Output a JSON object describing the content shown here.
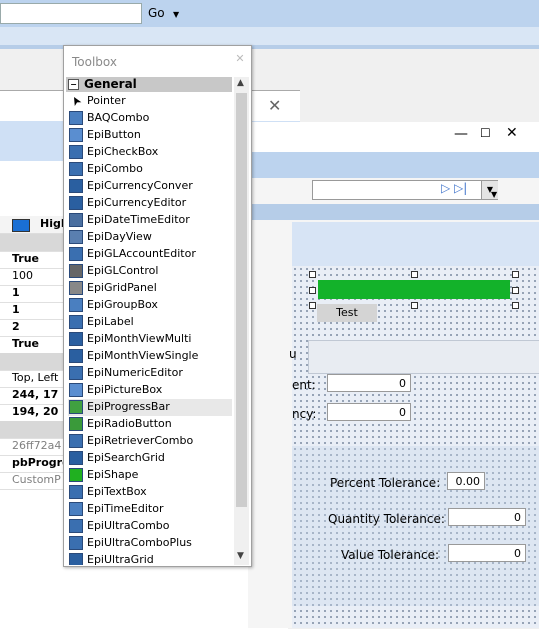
{
  "topbar": {
    "go_label": "Go",
    "go_dropdown": "▼"
  },
  "left_window": {
    "close_glyph": "✕",
    "header_text": "High",
    "rows": [
      {
        "text": "",
        "style": "h"
      },
      {
        "text": "True",
        "style": "b"
      },
      {
        "text": "100",
        "style": ""
      },
      {
        "text": "1",
        "style": "b"
      },
      {
        "text": "1",
        "style": "b"
      },
      {
        "text": "2",
        "style": "b"
      },
      {
        "text": "True",
        "style": "b"
      },
      {
        "text": "",
        "style": "h"
      },
      {
        "text": "Top, Left",
        "style": ""
      },
      {
        "text": "244, 17",
        "style": "b"
      },
      {
        "text": "194, 20",
        "style": "b"
      },
      {
        "text": "",
        "style": "h"
      },
      {
        "text": "26ff72a4",
        "style": "g"
      },
      {
        "text": "pbProgre",
        "style": "b"
      },
      {
        "text": "CustomP",
        "style": "g"
      }
    ]
  },
  "form_window": {
    "min_glyph": "—",
    "max_glyph": "☐",
    "close_glyph": "✕",
    "nav_glyphs": "▷ ▷|",
    "dropdown_glyph": "▼",
    "test_button": "Test",
    "field_labels": {
      "ent": "ent:",
      "ncy": "ncy:",
      "u": "u"
    },
    "ent_value": "0",
    "ncy_value": "0",
    "percent_label": "Percent Tolerance:",
    "percent_value": "0.00",
    "quantity_label": "Quantity Tolerance:",
    "quantity_value": "0",
    "value_label": "Value Tolerance:",
    "value_value": "0"
  },
  "toolbox": {
    "title": "Toolbox",
    "close_glyph": "✕",
    "group_label": "General",
    "group_toggle": "−",
    "items": [
      {
        "label": "Pointer",
        "icon": "pointer-icon",
        "color": "#ffffff"
      },
      {
        "label": "BAQCombo",
        "icon": "baqcombo-icon",
        "color": "#4a7fc0"
      },
      {
        "label": "EpiButton",
        "icon": "button-icon",
        "color": "#5a8ed0"
      },
      {
        "label": "EpiCheckBox",
        "icon": "checkbox-icon",
        "color": "#3a6fb0"
      },
      {
        "label": "EpiCombo",
        "icon": "combo-icon",
        "color": "#3a6fb0"
      },
      {
        "label": "EpiCurrencyConver",
        "icon": "currency-convert-icon",
        "color": "#2a5fa0"
      },
      {
        "label": "EpiCurrencyEditor",
        "icon": "currency-editor-icon",
        "color": "#2a5fa0"
      },
      {
        "label": "EpiDateTimeEditor",
        "icon": "datetime-icon",
        "color": "#4a6fa0"
      },
      {
        "label": "EpiDayView",
        "icon": "dayview-icon",
        "color": "#5a7fb0"
      },
      {
        "label": "EpiGLAccountEditor",
        "icon": "glaccount-icon",
        "color": "#3a6fb0"
      },
      {
        "label": "EpiGLControl",
        "icon": "glcontrol-icon",
        "color": "#666666"
      },
      {
        "label": "EpiGridPanel",
        "icon": "gridpanel-icon",
        "color": "#888888"
      },
      {
        "label": "EpiGroupBox",
        "icon": "groupbox-icon",
        "color": "#4a7fc0"
      },
      {
        "label": "EpiLabel",
        "icon": "label-icon",
        "color": "#3a6fb0"
      },
      {
        "label": "EpiMonthViewMulti",
        "icon": "monthview-multi-icon",
        "color": "#2a5fa0"
      },
      {
        "label": "EpiMonthViewSingle",
        "icon": "monthview-single-icon",
        "color": "#2a5fa0"
      },
      {
        "label": "EpiNumericEditor",
        "icon": "numeric-icon",
        "color": "#3a6fb0"
      },
      {
        "label": "EpiPictureBox",
        "icon": "picturebox-icon",
        "color": "#5a8ed0"
      },
      {
        "label": "EpiProgressBar",
        "icon": "progressbar-icon",
        "color": "#40a040"
      },
      {
        "label": "EpiRadioButton",
        "icon": "radio-icon",
        "color": "#3a9a3a"
      },
      {
        "label": "EpiRetrieverCombo",
        "icon": "retriever-icon",
        "color": "#3a6fb0"
      },
      {
        "label": "EpiSearchGrid",
        "icon": "searchgrid-icon",
        "color": "#2a5fa0"
      },
      {
        "label": "EpiShape",
        "icon": "shape-icon",
        "color": "#20b020"
      },
      {
        "label": "EpiTextBox",
        "icon": "textbox-icon",
        "color": "#3a6fb0"
      },
      {
        "label": "EpiTimeEditor",
        "icon": "time-icon",
        "color": "#4a7fc0"
      },
      {
        "label": "EpiUltraCombo",
        "icon": "ultracombo-icon",
        "color": "#3a6fb0"
      },
      {
        "label": "EpiUltraComboPlus",
        "icon": "ultracomboplus-icon",
        "color": "#3a6fb0"
      },
      {
        "label": "EpiUltraGrid",
        "icon": "ultragrid-icon",
        "color": "#2a5fa0"
      }
    ],
    "selected_index": 18
  },
  "colors": {
    "accent": "#bcd3ee",
    "progress": "#13b22a"
  }
}
